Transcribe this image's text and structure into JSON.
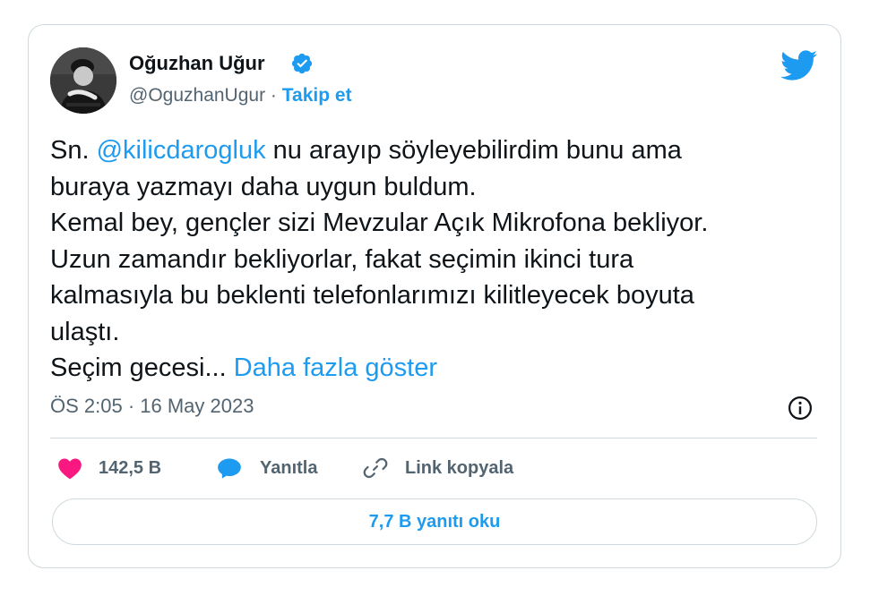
{
  "author": {
    "name": "Oğuzhan Uğur",
    "handle": "@OguzhanUgur",
    "separator": "·",
    "follow_label": "Takip et"
  },
  "tweet": {
    "mention": "@kilicdarogluk",
    "line1_prefix": "Sn.",
    "line1_suffix": "nu arayıp söyleyebilirdim bunu ama",
    "line2": "buraya yazmayı daha uygun buldum.",
    "line3": "Kemal bey, gençler sizi Mevzular Açık Mikrofona bekliyor.",
    "line4": "Uzun zamandır bekliyorlar, fakat seçimin ikinci tura",
    "line5": "kalmasıyla bu beklenti telefonlarımızı kilitleyecek boyuta",
    "line6": "ulaştı.",
    "line7_prefix": "Seçim gecesi...",
    "show_more": "Daha fazla göster"
  },
  "timestamp": "ÖS 2:05 · 16 May 2023",
  "actions": {
    "like_count": "142,5 B",
    "reply_label": "Yanıtla",
    "copy_link_label": "Link kopyala"
  },
  "read_replies_label": "7,7 B yanıtı oku",
  "icons": {
    "verified": "verified-badge-icon",
    "bird": "twitter-bird-icon",
    "info": "info-icon",
    "like": "heart-icon",
    "reply": "speech-bubble-icon",
    "copy_link": "link-icon"
  },
  "colors": {
    "accent": "#1d9bf0",
    "like": "#f91880",
    "text": "#0f1419",
    "secondary": "#536471",
    "border": "#cfd9de"
  }
}
